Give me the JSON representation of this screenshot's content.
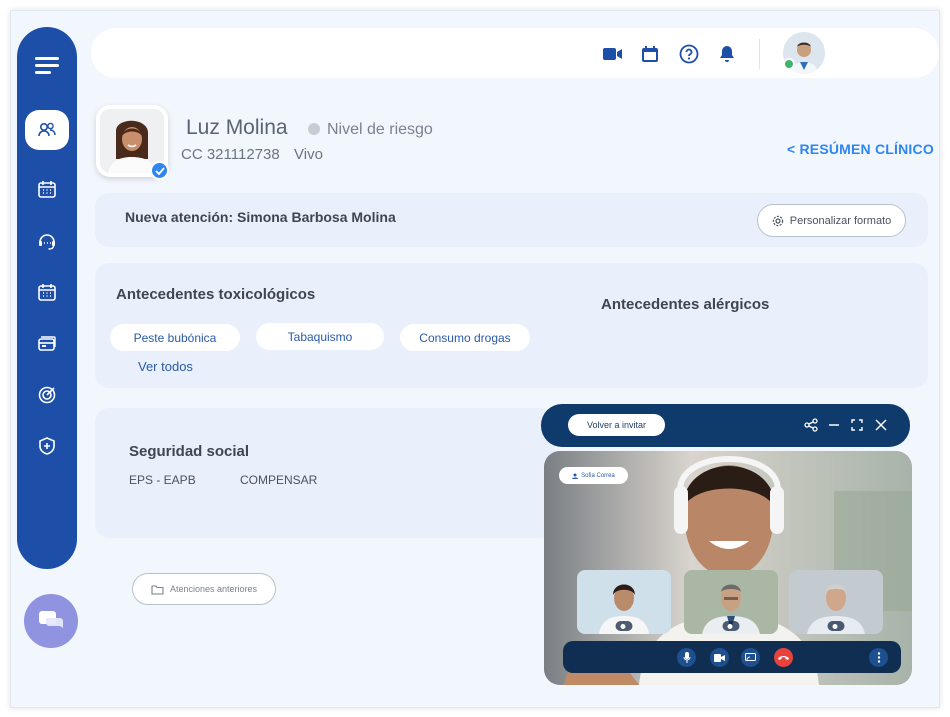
{
  "patient": {
    "name": "Luz Molina",
    "risk_label": "Nivel de riesgo",
    "id_label": "CC 321112738",
    "status": "Vivo"
  },
  "header": {
    "resumen_link": "< RESÚMEN CLÍNICO"
  },
  "attention": {
    "title": "Nueva atención: Simona Barbosa Molina",
    "customize_button": "Personalizar formato"
  },
  "toxicologicos": {
    "title": "Antecedentes toxicológicos",
    "chips": [
      "Peste bubónica",
      "Tabaquismo",
      "Consumo drogas"
    ],
    "see_all": "Ver todos"
  },
  "alergicos": {
    "title": "Antecedentes alérgicos"
  },
  "seguridad": {
    "title": "Seguridad social",
    "eps": "EPS - EAPB",
    "entity": "COMPENSAR"
  },
  "previous": {
    "label": "Atenciones anteriores"
  },
  "videocall": {
    "back_button": "Volver a invitar",
    "speaker_tag": "Sofia Correa",
    "participants": [
      "",
      "",
      ""
    ]
  },
  "colors": {
    "sidebar": "#1e4fa8",
    "accent": "#2e86f0",
    "call_bar": "#0f3b6c",
    "hangup": "#e8423c"
  }
}
